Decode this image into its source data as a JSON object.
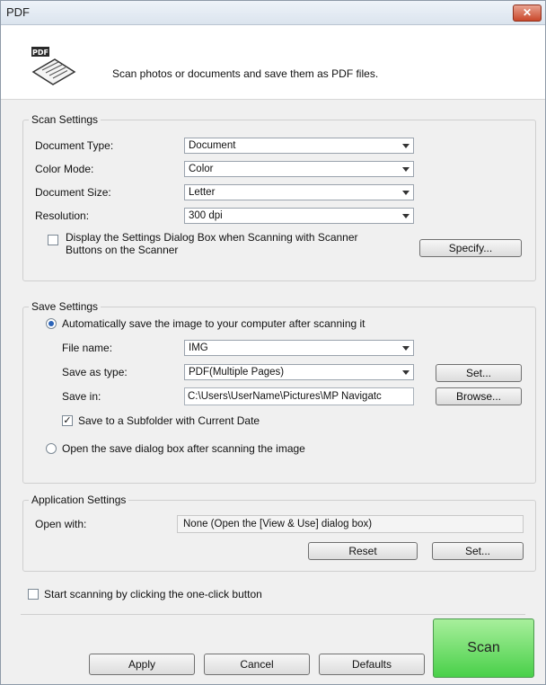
{
  "window": {
    "title": "PDF",
    "close_symbol": "✕"
  },
  "header": {
    "description": "Scan photos or documents and save them as PDF files.",
    "icon": "pdf-scan-icon"
  },
  "scan_settings": {
    "group_label": "Scan Settings",
    "document_type": {
      "label": "Document Type:",
      "value": "Document"
    },
    "color_mode": {
      "label": "Color Mode:",
      "value": "Color"
    },
    "document_size": {
      "label": "Document Size:",
      "value": "Letter"
    },
    "resolution": {
      "label": "Resolution:",
      "value": "300 dpi"
    },
    "display_settings_checkbox": {
      "label_line1": "Display the Settings Dialog Box when Scanning with Scanner",
      "label_line2": "Buttons on the Scanner",
      "checked": false
    },
    "specify_button": "Specify..."
  },
  "save_settings": {
    "group_label": "Save Settings",
    "auto_save_radio": {
      "label": "Automatically save the image to your computer after scanning it",
      "selected": true
    },
    "file_name": {
      "label": "File name:",
      "value": "IMG"
    },
    "save_as_type": {
      "label": "Save as type:",
      "value": "PDF(Multiple Pages)"
    },
    "set_button": "Set...",
    "save_in": {
      "label": "Save in:",
      "value": "C:\\Users\\UserName\\Pictures\\MP Navigatc"
    },
    "browse_button": "Browse...",
    "subfolder_checkbox": {
      "label": "Save to a Subfolder with Current Date",
      "checked": true
    },
    "open_dialog_radio": {
      "label": "Open the save dialog box after scanning the image",
      "selected": false
    }
  },
  "application_settings": {
    "group_label": "Application Settings",
    "open_with": {
      "label": "Open with:",
      "value": "None (Open the [View & Use] dialog box)"
    },
    "reset_button": "Reset",
    "set_button": "Set..."
  },
  "one_click_checkbox": {
    "label": "Start scanning by clicking the one-click button",
    "checked": false
  },
  "footer": {
    "apply_button": "Apply",
    "cancel_button": "Cancel",
    "defaults_button": "Defaults",
    "scan_button": "Scan"
  },
  "check_mark": "✓"
}
